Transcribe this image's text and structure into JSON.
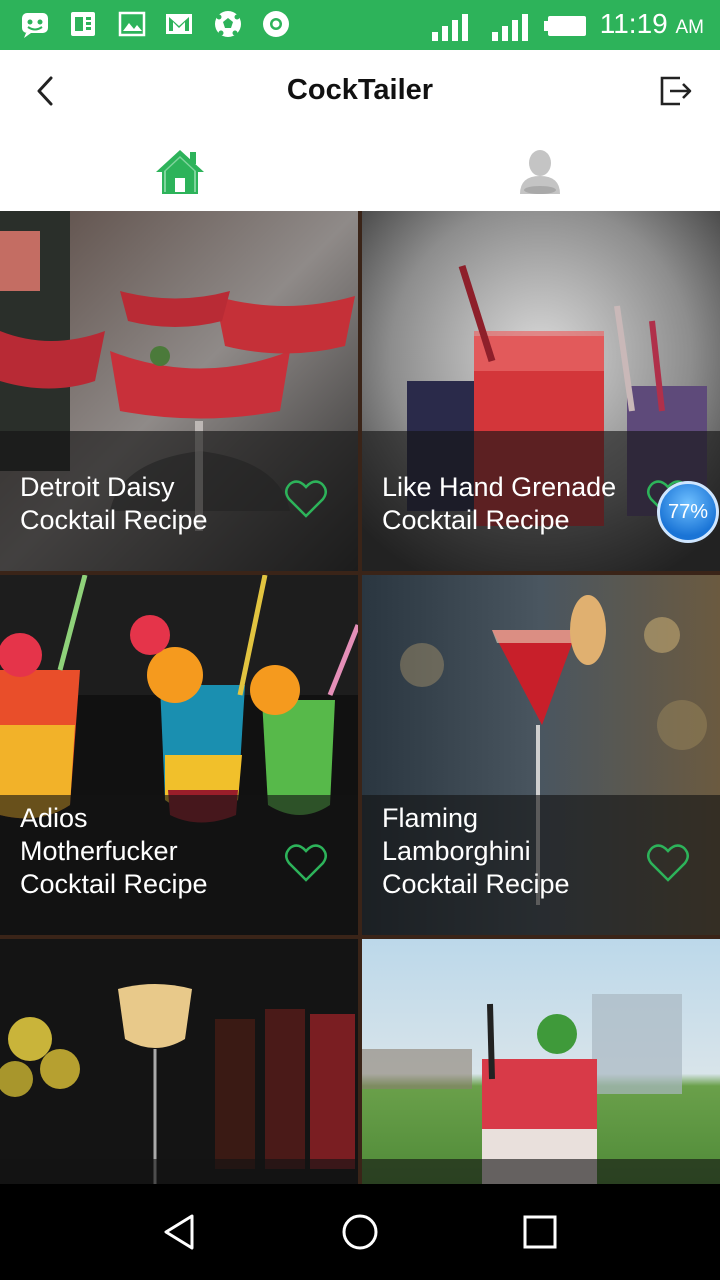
{
  "status_bar": {
    "time": "11:19",
    "ampm": "AM",
    "background": "#2db35a"
  },
  "app_bar": {
    "title": "CockTailer"
  },
  "tabs": [
    {
      "name": "home",
      "selected": true,
      "color": "#2db35a"
    },
    {
      "name": "profile",
      "selected": false,
      "color": "#c4c4c4"
    }
  ],
  "recipes": [
    {
      "line1": "Detroit Daisy",
      "line2": "Cocktail Recipe",
      "favorite": false
    },
    {
      "line1": "Like Hand Grenade",
      "line2": "Cocktail Recipe",
      "favorite": false
    },
    {
      "line1": "Adios",
      "line2": "Motherfucker",
      "line3": "Cocktail Recipe",
      "favorite": false
    },
    {
      "line1": "Flaming",
      "line2": "Lamborghini",
      "line3": "Cocktail Recipe",
      "favorite": false
    }
  ],
  "badge": {
    "text": "77%"
  },
  "colors": {
    "accent": "#2db35a",
    "heart": "#2db35a"
  }
}
